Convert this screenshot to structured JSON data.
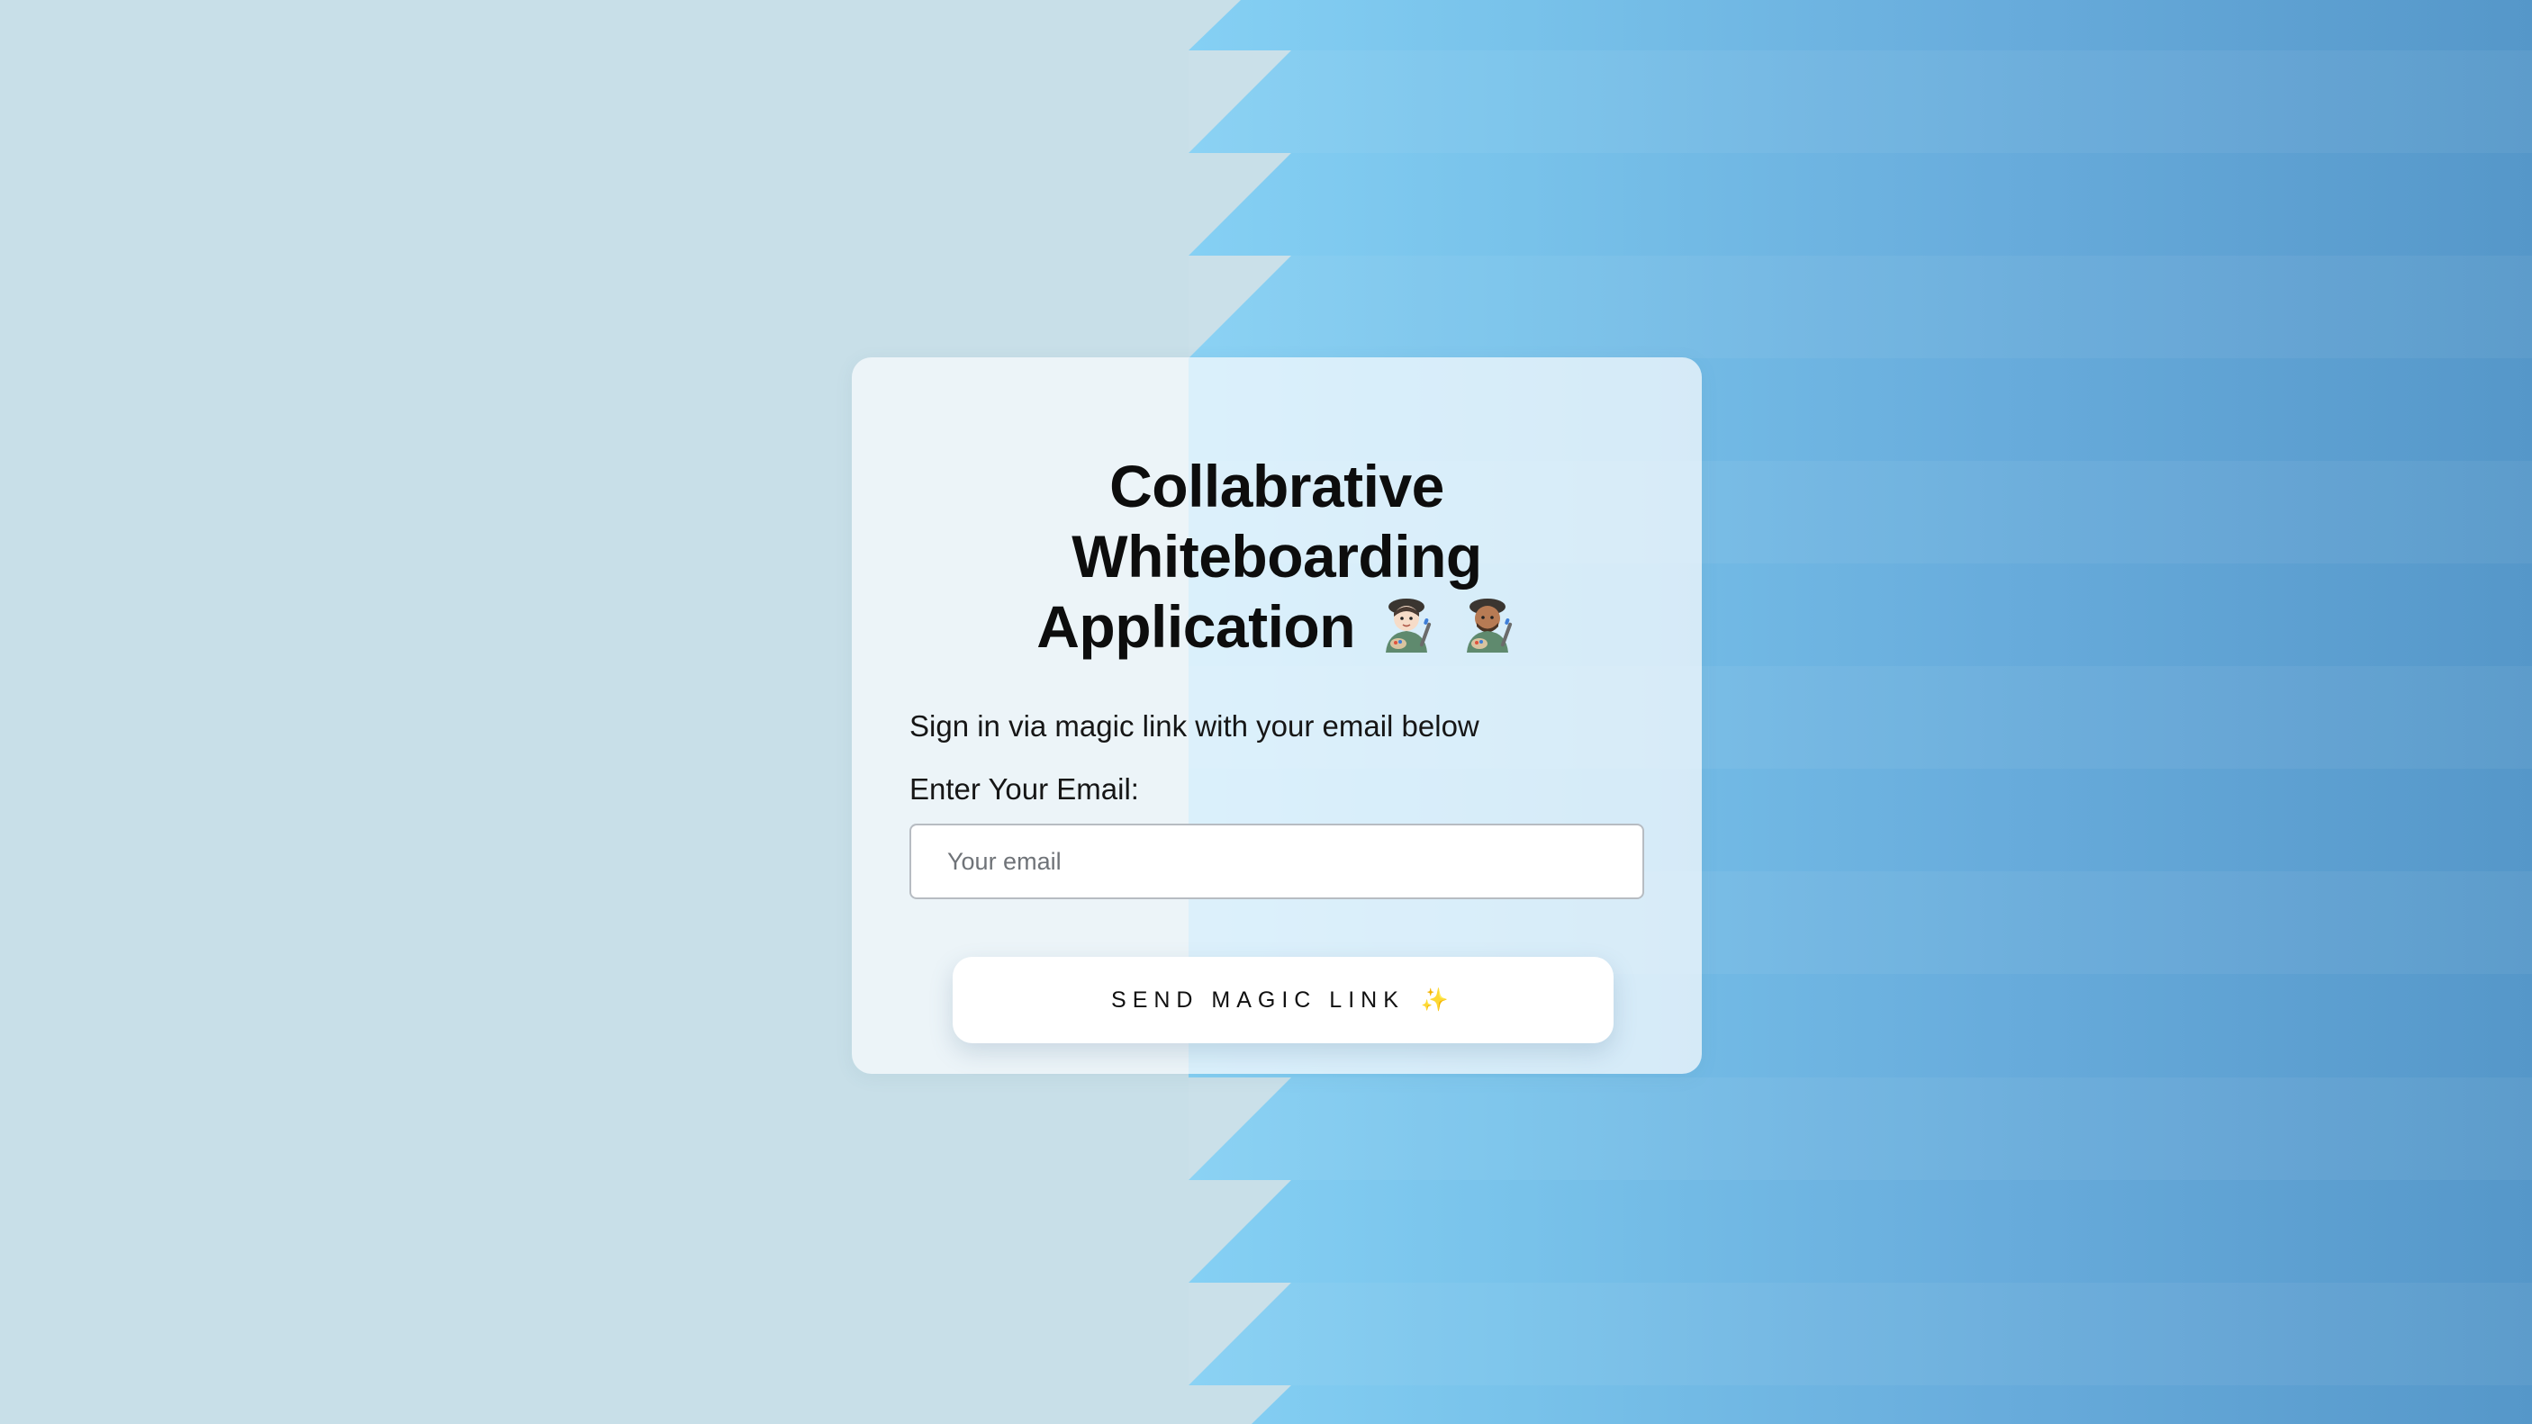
{
  "login": {
    "title_line1": "Collabrative Whiteboarding",
    "title_line2": "Application",
    "title_emojis": [
      "woman-artist-icon",
      "man-artist-icon"
    ],
    "subtitle": "Sign in via magic link with your email below",
    "email_label": "Enter Your Email:",
    "email_placeholder": "Your email",
    "email_value": "",
    "button_label": "SEND MAGIC LINK",
    "button_emoji": "✨"
  },
  "colors": {
    "page_left": "#c8dfe8",
    "page_right_start": "#85d0f4",
    "page_right_end": "#5597c9",
    "card": "#f8fbfd",
    "button": "#ffffff",
    "text": "#0d0d0d"
  }
}
